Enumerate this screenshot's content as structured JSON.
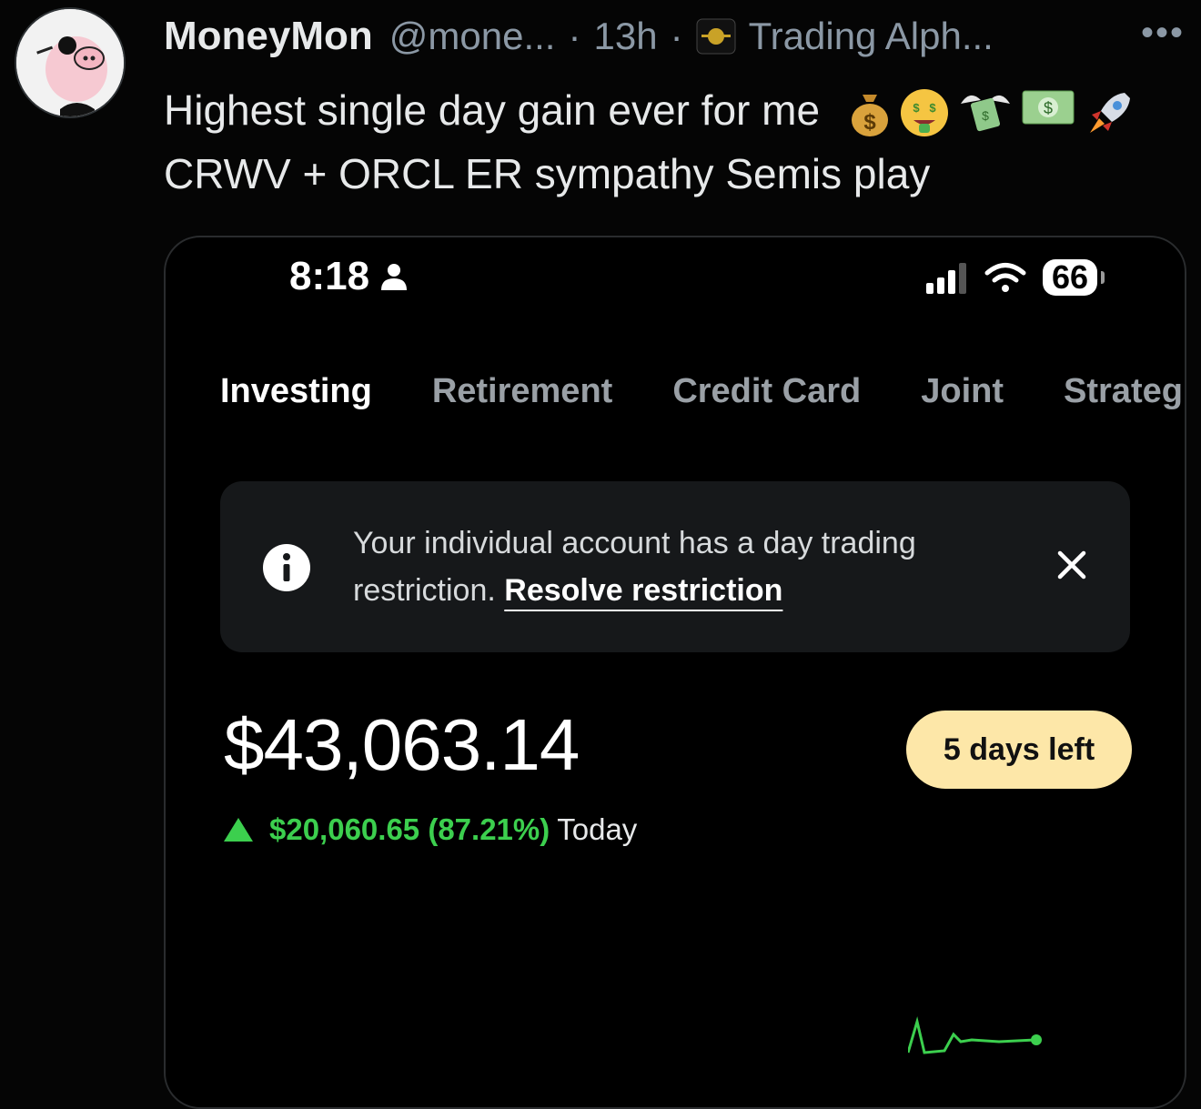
{
  "tweet": {
    "author_name": "MoneyMon",
    "handle": "@mone...",
    "separator": "·",
    "time": "13h",
    "community": "Trading Alph...",
    "more": "•••",
    "text_line1": "Highest single day gain ever for me",
    "emojis": [
      "money-bag",
      "money-mouth-face",
      "money-with-wings",
      "dollar-banknote",
      "rocket"
    ],
    "text_line2": "CRWV + ORCL ER sympathy Semis play"
  },
  "phone": {
    "status": {
      "time": "8:18",
      "battery": "66"
    },
    "tabs": [
      "Investing",
      "Retirement",
      "Credit Card",
      "Joint",
      "Strategi"
    ],
    "active_tab": "Investing",
    "notice": {
      "text": "Your individual account has a day trading restriction.",
      "link": "Resolve restriction"
    },
    "balance": "$43,063.14",
    "days_left": "5 days left",
    "gain": {
      "amount_pct": "$20,060.65 (87.21%)",
      "period": "Today"
    },
    "colors": {
      "gain": "#3ccf4e",
      "pill": "#fde7a8"
    }
  }
}
